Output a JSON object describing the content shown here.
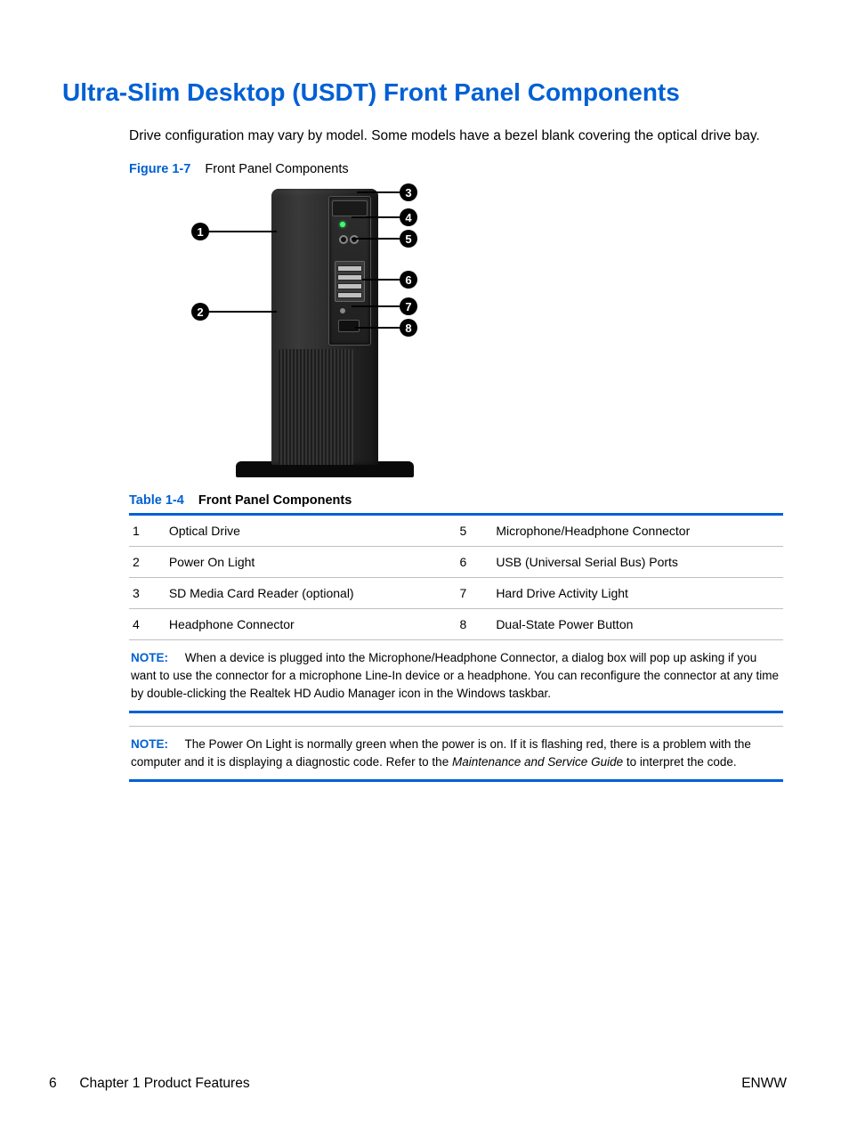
{
  "heading": "Ultra-Slim Desktop (USDT) Front Panel Components",
  "intro": "Drive configuration may vary by model. Some models have a bezel blank covering the optical drive bay.",
  "figure": {
    "label": "Figure 1-7",
    "title": "Front Panel Components"
  },
  "table": {
    "label": "Table 1-4",
    "title": "Front Panel Components",
    "rows": [
      {
        "n1": "1",
        "d1": "Optical Drive",
        "n2": "5",
        "d2": "Microphone/Headphone Connector"
      },
      {
        "n1": "2",
        "d1": "Power On Light",
        "n2": "6",
        "d2": "USB (Universal Serial Bus) Ports"
      },
      {
        "n1": "3",
        "d1": "SD Media Card Reader (optional)",
        "n2": "7",
        "d2": "Hard Drive Activity Light"
      },
      {
        "n1": "4",
        "d1": "Headphone Connector",
        "n2": "8",
        "d2": "Dual-State Power Button"
      }
    ]
  },
  "notes": {
    "label": "NOTE:",
    "n1": "When a device is plugged into the Microphone/Headphone Connector, a dialog box will pop up asking if you want to use the connector for a microphone Line-In device or a headphone. You can reconfigure the connector at any time by double-clicking the Realtek HD Audio Manager icon in the Windows taskbar.",
    "n2a": "The Power On Light is normally green when the power is on. If it is flashing red, there is a problem with the computer and it is displaying a diagnostic code. Refer to the ",
    "n2i": "Maintenance and Service Guide",
    "n2b": " to interpret the code."
  },
  "callouts": [
    "1",
    "2",
    "3",
    "4",
    "5",
    "6",
    "7",
    "8"
  ],
  "footer": {
    "page": "6",
    "chapter": "Chapter 1   Product Features",
    "right": "ENWW"
  }
}
